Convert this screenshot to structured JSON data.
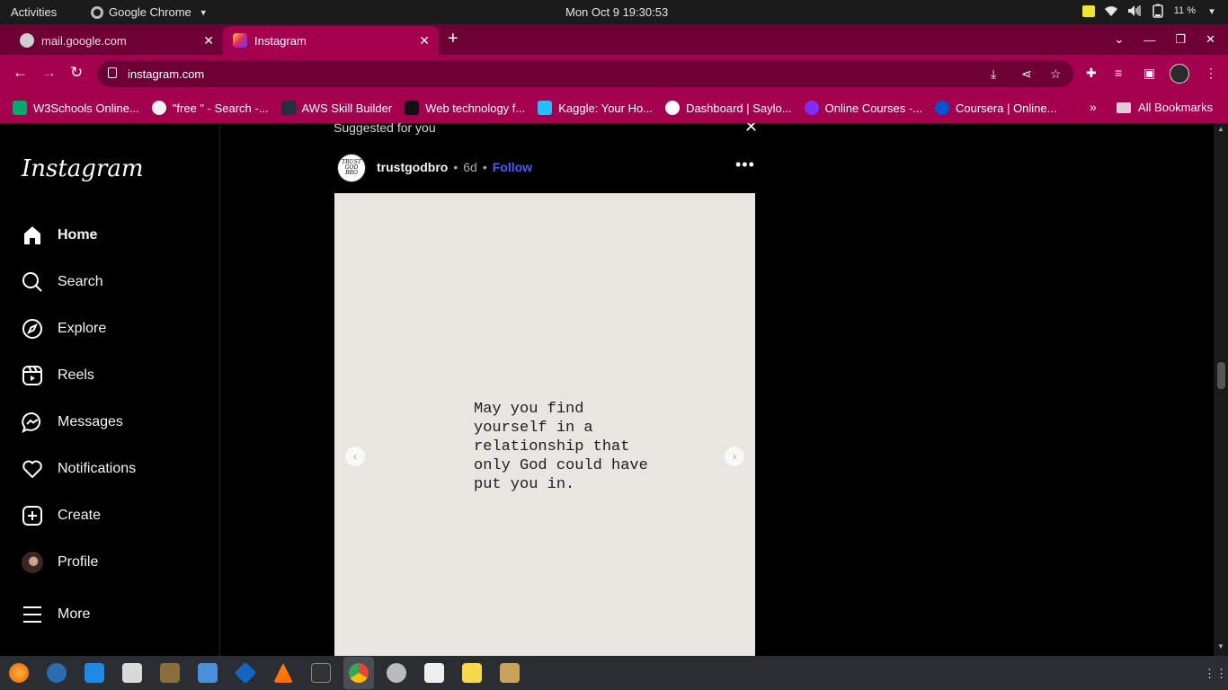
{
  "system_bar": {
    "activities": "Activities",
    "app_name": "Google Chrome",
    "clock": "Mon Oct 9  19:30:53",
    "battery": "11 %"
  },
  "browser": {
    "tabs": [
      {
        "label": "mail.google.com"
      },
      {
        "label": "Instagram"
      }
    ],
    "url": "instagram.com",
    "bookmarks": [
      {
        "label": "W3Schools Online...",
        "color": "#04aa6d"
      },
      {
        "label": "\"free \" - Search -...",
        "color": "#f2f2f2"
      },
      {
        "label": "AWS Skill Builder",
        "color": "#232f3e"
      },
      {
        "label": "Web technology f...",
        "color": "#111111"
      },
      {
        "label": "Kaggle: Your Ho...",
        "color": "#20beff"
      },
      {
        "label": "Dashboard | Saylo...",
        "color": "#ffffff"
      },
      {
        "label": "Online Courses -...",
        "color": "#7b2ff7"
      },
      {
        "label": "Coursera | Online...",
        "color": "#0056d2"
      }
    ],
    "all_bookmarks": "All Bookmarks"
  },
  "sidebar": {
    "logo": "Instagram",
    "items": [
      {
        "label": "Home",
        "icon": "home-icon"
      },
      {
        "label": "Search",
        "icon": "search-icon"
      },
      {
        "label": "Explore",
        "icon": "compass-icon"
      },
      {
        "label": "Reels",
        "icon": "reels-icon"
      },
      {
        "label": "Messages",
        "icon": "messenger-icon"
      },
      {
        "label": "Notifications",
        "icon": "heart-icon"
      },
      {
        "label": "Create",
        "icon": "plus-square-icon"
      },
      {
        "label": "Profile",
        "icon": "profile-avatar"
      },
      {
        "label": "More",
        "icon": "menu-icon"
      }
    ]
  },
  "feed": {
    "section_title": "Suggested for you",
    "post": {
      "avatar_text": "TRUST GOD BRO",
      "username": "trustgodbro",
      "separator": "•",
      "age": "6d",
      "follow": "Follow",
      "quote": "May you find yourself in a relationship that only God could have put you in."
    }
  },
  "colors": {
    "chrome_frame": "#6e0035",
    "chrome_toolbar": "#a4004f",
    "follow_link": "#4a5df9"
  }
}
